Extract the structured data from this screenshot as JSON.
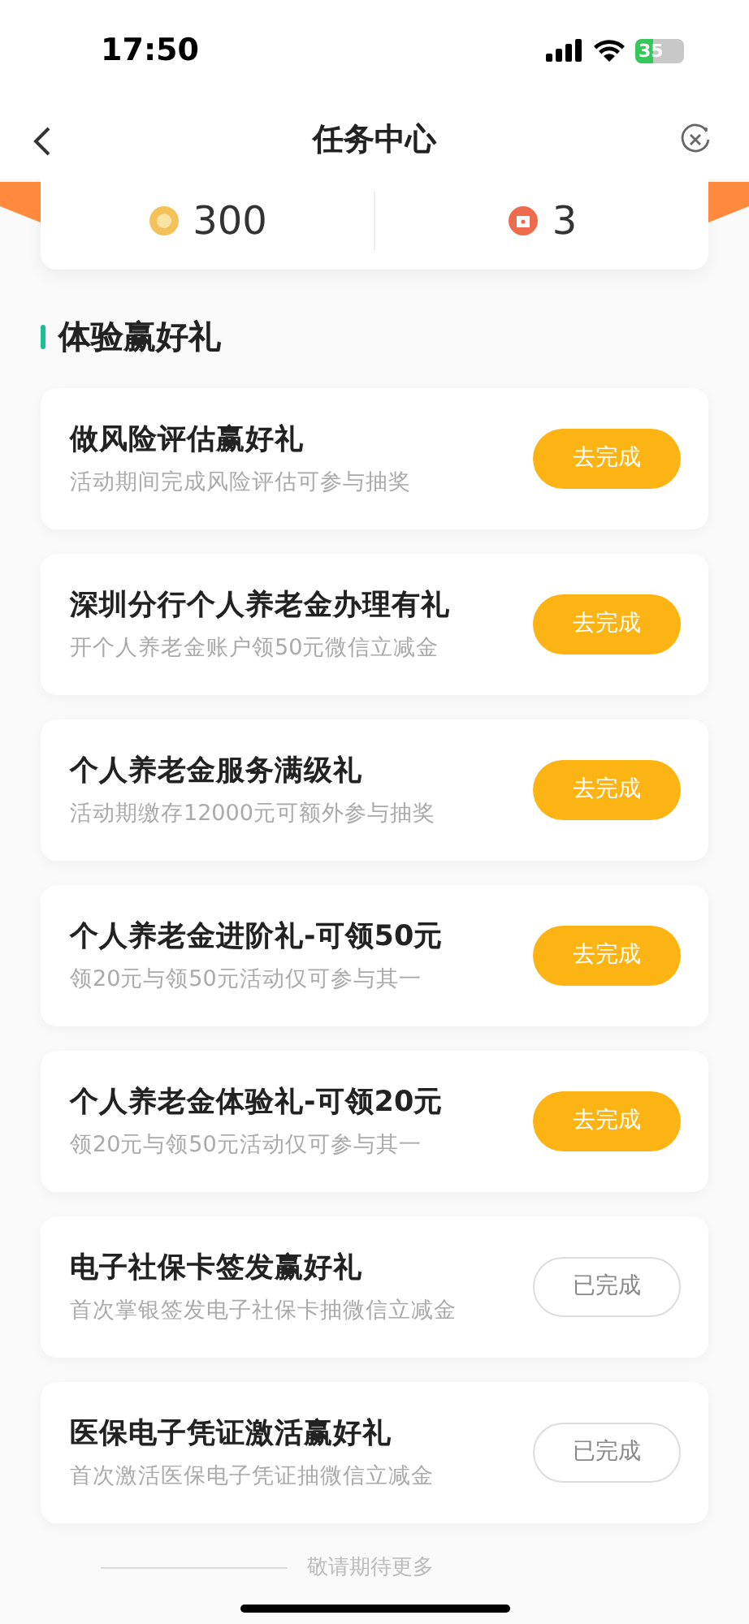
{
  "status_bar": {
    "time": "17:50",
    "battery": "35"
  },
  "nav": {
    "title": "任务中心"
  },
  "stats": [
    {
      "kind": "coin",
      "value": "300"
    },
    {
      "kind": "ticket",
      "value": "3"
    }
  ],
  "section": {
    "title": "体验赢好礼"
  },
  "tasks": [
    {
      "title": "做风险评估赢好礼",
      "desc": "活动期间完成风险评估可参与抽奖",
      "button": "去完成",
      "done": false
    },
    {
      "title": "深圳分行个人养老金办理有礼",
      "desc": "开个人养老金账户领50元微信立减金",
      "button": "去完成",
      "done": false
    },
    {
      "title": "个人养老金服务满级礼",
      "desc": "活动期缴存12000元可额外参与抽奖",
      "button": "去完成",
      "done": false
    },
    {
      "title": "个人养老金进阶礼-可领50元",
      "desc": "领20元与领50元活动仅可参与其一",
      "button": "去完成",
      "done": false
    },
    {
      "title": "个人养老金体验礼-可领20元",
      "desc": "领20元与领50元活动仅可参与其一",
      "button": "去完成",
      "done": false
    },
    {
      "title": "电子社保卡签发赢好礼",
      "desc": "首次掌银签发电子社保卡抽微信立减金",
      "button": "已完成",
      "done": true
    },
    {
      "title": "医保电子凭证激活赢好礼",
      "desc": "首次激活医保电子凭证抽微信立减金",
      "button": "已完成",
      "done": true
    }
  ],
  "footer": {
    "text": "敬请期待更多"
  }
}
